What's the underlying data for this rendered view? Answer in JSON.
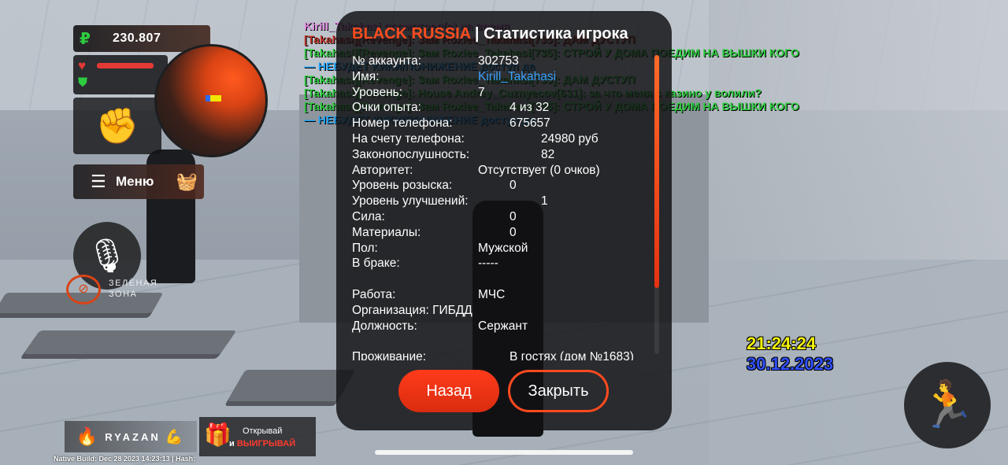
{
  "hud": {
    "money": "230.807",
    "money_icon": "ruble-icon",
    "menu_label": "Меню",
    "green_zone_line1": "ЗЕЛЁНАЯ",
    "green_zone_line2": "ЗОНА",
    "server_name": "RYAZAN",
    "promo_line1": "Открывай",
    "promo_line2_prefix": "и ",
    "promo_line2_accent": "ВЫИГРЫВАЙ",
    "native_build": "Native Build: Dec 28 2023 14:23:13 | Hash:"
  },
  "chat": [
    {
      "text": "Kirill_Takahasi посмотрел(а) на время",
      "color": "#e08ae0"
    },
    {
      "text": "[Takahasi][Revenge]: Зам Roxiee_Takahasi[735]: ДАМ ДУСТУП",
      "color": "#c0392b"
    },
    {
      "text": "[Takahasi][Revenge]: Зам Roxiee_Takahasi[735]: СТРОЙ У ДОМА ПОЕДИМ НА ВЫШКИ КОГО",
      "color": "#2ecc40"
    },
    {
      "text": "— НЕБУДЕТ КИКИ/ПОНИЖЕНИЕ доступ да",
      "color": "#1da1f2"
    },
    {
      "text": "[Takahasi][Revenge]: Зам Roxiee_Takahasi[735]: ДАМ ДУСТУП",
      "color": "#2ecc40"
    },
    {
      "text": "[Takahasi][Revenge]: House Andrey_Cuznyecov[631]: за что меня с казино у волили?",
      "color": "#2ecc40"
    },
    {
      "text": "[Takahasi][Revenge]: Зам Roxiee_Takahasi[735]: СТРОЙ У ДОМА ПОЕДИМ НА ВЫШКИ КОГО",
      "color": "#2ecc40"
    },
    {
      "text": "— НЕБУДЕТ КИКИ/ПОНИЖЕНИЕ доступ да",
      "color": "#1da1f2"
    }
  ],
  "dialog": {
    "brand": "BLACK RUSSIA",
    "title": " | Статистика игрока",
    "rows": [
      {
        "key": "№ аккаунта:",
        "value": "302753",
        "vx": 160
      },
      {
        "key": "Имя:",
        "value": "Kirill_Takahasi",
        "vx": 160,
        "link": true
      },
      {
        "key": "Уровень:",
        "value": "7",
        "vx": 160
      },
      {
        "key": "Очки опыта:",
        "value": "4 из 32",
        "vx": 200
      },
      {
        "key": "Номер телефона:",
        "value": "675657",
        "vx": 200
      },
      {
        "key": "На счету телефона:",
        "value": "24980 руб",
        "vx": 240
      },
      {
        "key": "Законопослушность:",
        "value": "82",
        "vx": 240
      },
      {
        "key": "Авторитет:",
        "value": "Отсутствует (0 очков)",
        "vx": 160
      },
      {
        "key": "Уровень розыска:",
        "value": "0",
        "vx": 200
      },
      {
        "key": "Уровень улучшений:",
        "value": "1",
        "vx": 240
      },
      {
        "key": "Сила:",
        "value": "0",
        "vx": 200
      },
      {
        "key": "Материалы:",
        "value": "0",
        "vx": 200
      },
      {
        "key": "Пол:",
        "value": "Мужской",
        "vx": 160
      },
      {
        "key": "В браке:",
        "value": "-----",
        "vx": 160
      },
      {
        "key": "",
        "value": "",
        "vx": 160
      },
      {
        "key": "Работа:",
        "value": "МЧС",
        "vx": 160
      },
      {
        "key": "Организация: ГИБДД",
        "value": "",
        "vx": 160
      },
      {
        "key": "Должность:",
        "value": "Сержант",
        "vx": 160
      },
      {
        "key": "",
        "value": "",
        "vx": 160
      },
      {
        "key": "Проживание:",
        "value": "В гостях (дом №1683)",
        "vx": 200
      }
    ],
    "back_label": "Назад",
    "close_label": "Закрыть"
  },
  "clock": {
    "time": "21:24:24",
    "date": "30.12.2023"
  }
}
